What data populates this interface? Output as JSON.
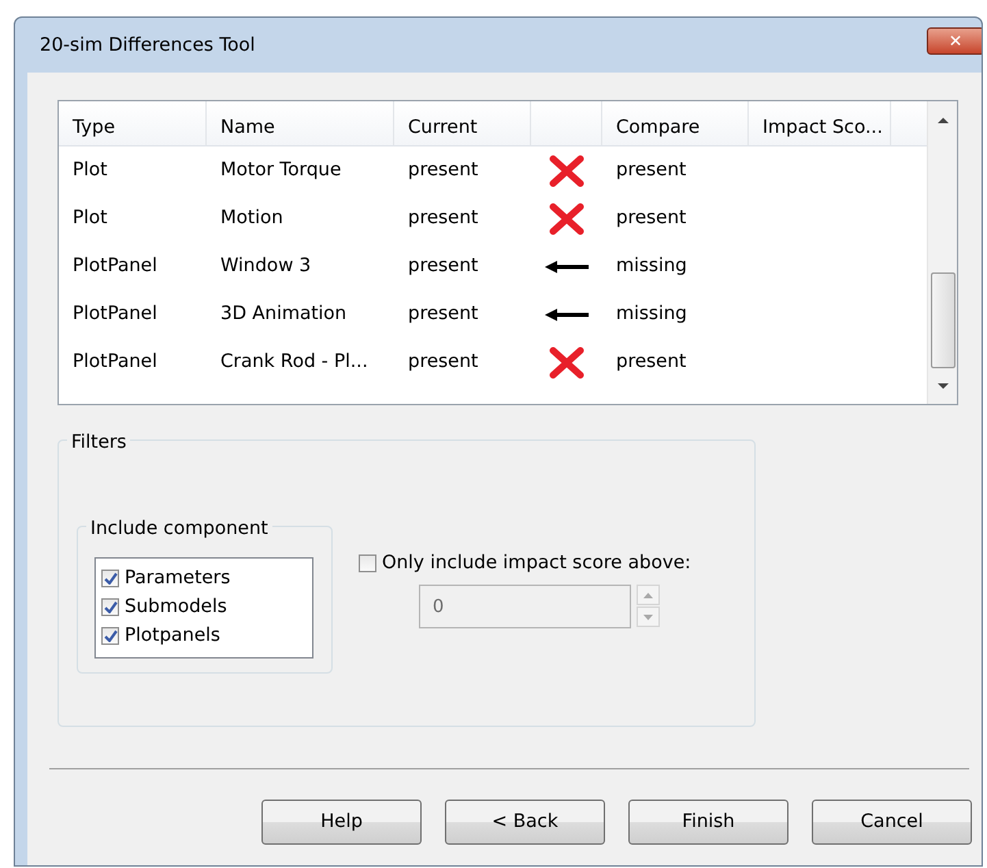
{
  "window": {
    "title": "20-sim Differences Tool",
    "close": "✕"
  },
  "table": {
    "columns": [
      "Type",
      "Name",
      "Current",
      "",
      "Compare",
      "Impact Sco..."
    ],
    "rows": [
      {
        "type": "Plot",
        "name": "Motor Torque",
        "current": "present",
        "kind": "cross",
        "compare": "present"
      },
      {
        "type": "Plot",
        "name": "Motion",
        "current": "present",
        "kind": "cross",
        "compare": "present"
      },
      {
        "type": "PlotPanel",
        "name": "Window 3",
        "current": "present",
        "kind": "arrow",
        "compare": "missing"
      },
      {
        "type": "PlotPanel",
        "name": "3D Animation",
        "current": "present",
        "kind": "arrow",
        "compare": "missing"
      },
      {
        "type": "PlotPanel",
        "name": "Crank Rod - Pl...",
        "current": "present",
        "kind": "cross",
        "compare": "present"
      }
    ]
  },
  "filters": {
    "title": "Filters",
    "include": {
      "title": "Include component",
      "items": [
        {
          "label": "Parameters",
          "checked": true
        },
        {
          "label": "Submodels",
          "checked": true
        },
        {
          "label": "Plotpanels",
          "checked": true
        }
      ]
    },
    "impact": {
      "label": "Only include impact score above:",
      "checked": false,
      "value": "0"
    }
  },
  "buttons": [
    "Help",
    "< Back",
    "Finish",
    "Cancel"
  ]
}
